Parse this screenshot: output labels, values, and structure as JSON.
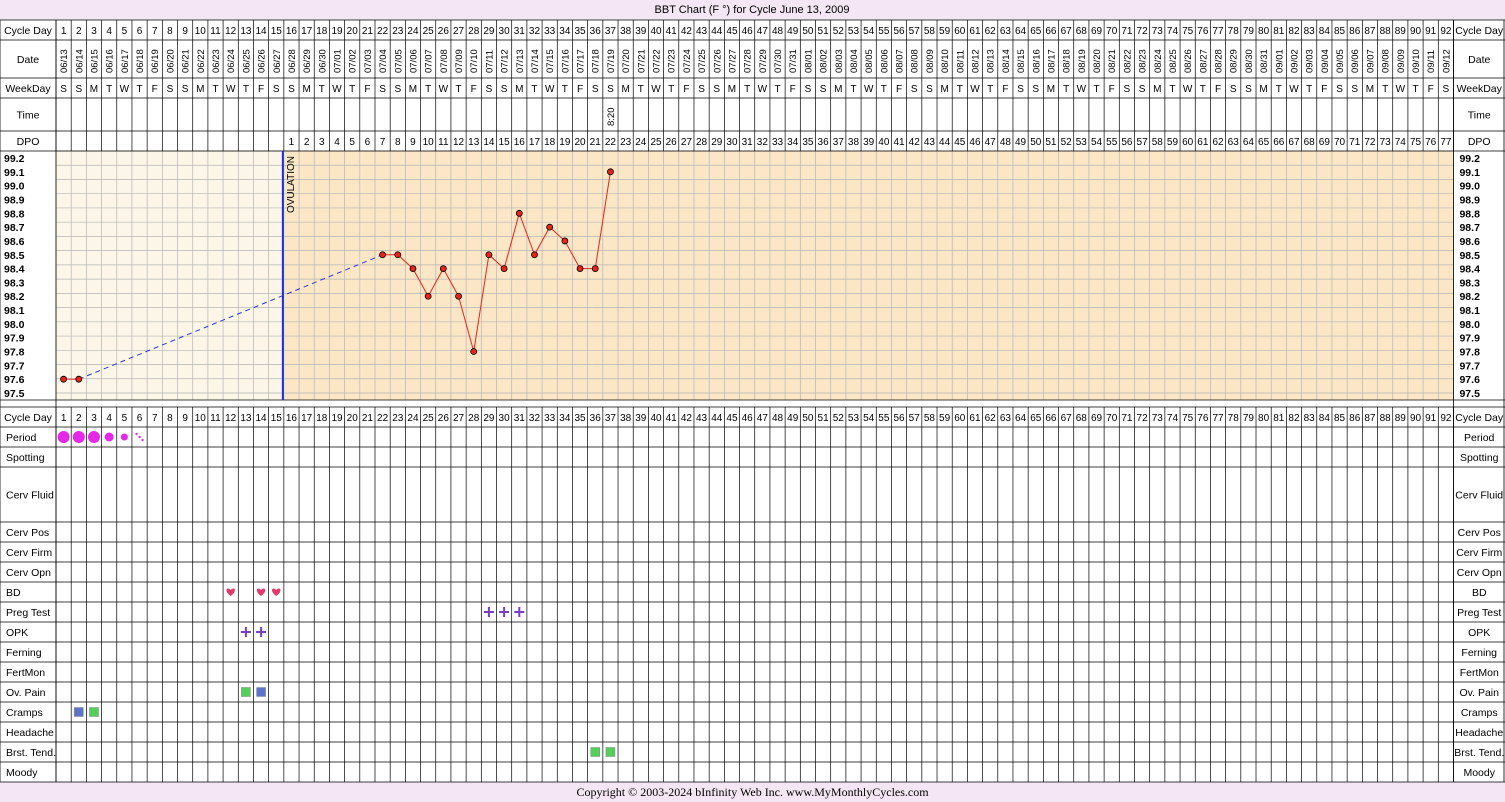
{
  "title": "BBT Chart (F °) for Cycle June 13, 2009",
  "copyright": "Copyright © 2003-2024 bInfinity Web Inc.     www.MyMonthlyCycles.com",
  "ovulation_label": "OVULATION",
  "row_labels": {
    "cycle_day": "Cycle Day",
    "date": "Date",
    "weekday": "WeekDay",
    "time": "Time",
    "dpo": "DPO"
  },
  "observation_rows": [
    "Cycle Day",
    "Period",
    "Spotting",
    "Cerv Fluid",
    "Cerv Pos",
    "Cerv Firm",
    "Cerv Opn",
    "BD",
    "Preg Test",
    "OPK",
    "Ferning",
    "FertMon",
    "Ov. Pain",
    "Cramps",
    "Headache",
    "Brst. Tend.",
    "Moody"
  ],
  "dates": [
    "06/13",
    "06/14",
    "06/15",
    "06/16",
    "06/17",
    "06/18",
    "06/19",
    "06/20",
    "06/21",
    "06/22",
    "06/23",
    "06/24",
    "06/25",
    "06/26",
    "06/27",
    "06/28",
    "06/29",
    "06/30",
    "07/01",
    "07/02",
    "07/03",
    "07/04",
    "07/05",
    "07/06",
    "07/07",
    "07/08",
    "07/09",
    "07/10",
    "07/11",
    "07/12",
    "07/13",
    "07/14",
    "07/15",
    "07/16",
    "07/17",
    "07/18",
    "07/19",
    "07/20",
    "07/21",
    "07/22",
    "07/23",
    "07/24",
    "07/25",
    "07/26",
    "07/27",
    "07/28",
    "07/29",
    "07/30",
    "07/31",
    "08/01",
    "08/02",
    "08/03",
    "08/04",
    "08/05",
    "08/06",
    "08/07",
    "08/08",
    "08/09",
    "08/10",
    "08/11",
    "08/12",
    "08/13",
    "08/14",
    "08/15",
    "08/16",
    "08/17",
    "08/18",
    "08/19",
    "08/20",
    "08/21",
    "08/22",
    "08/23",
    "08/24",
    "08/25",
    "08/26",
    "08/27",
    "08/28",
    "08/29",
    "08/30",
    "08/31",
    "09/01",
    "09/02",
    "09/03",
    "09/04",
    "09/05",
    "09/06",
    "09/07",
    "09/08",
    "09/09",
    "09/10",
    "09/11",
    "09/12"
  ],
  "weekdays": [
    "S",
    "S",
    "M",
    "T",
    "W",
    "T",
    "F",
    "S",
    "S",
    "M",
    "T",
    "W",
    "T",
    "F",
    "S",
    "S",
    "M",
    "T",
    "W",
    "T",
    "F",
    "S",
    "S",
    "M",
    "T",
    "W",
    "T",
    "F",
    "S",
    "S",
    "M",
    "T",
    "W",
    "T",
    "F",
    "S",
    "S",
    "M",
    "T",
    "W",
    "T",
    "F",
    "S",
    "S",
    "M",
    "T",
    "W",
    "T",
    "F",
    "S",
    "S",
    "M",
    "T",
    "W",
    "T",
    "F",
    "S",
    "S",
    "M",
    "T",
    "W",
    "T",
    "F",
    "S",
    "S",
    "M",
    "T",
    "W",
    "T",
    "F",
    "S",
    "S",
    "M",
    "T",
    "W",
    "T",
    "F",
    "S",
    "S",
    "M",
    "T",
    "W",
    "T",
    "F",
    "S",
    "S",
    "M",
    "T",
    "W",
    "T",
    "F",
    "S"
  ],
  "times": [
    {
      "day": 37,
      "text": "8:20"
    }
  ],
  "dpo_start_day": 16,
  "dpo_count": 77,
  "chart_data": {
    "type": "line",
    "title": "BBT Chart (F °) for Cycle June 13, 2009",
    "x_label": "Cycle Day",
    "y_label": "",
    "x_range": [
      1,
      92
    ],
    "ylim": [
      97.5,
      99.2
    ],
    "y_ticks": [
      "99.2",
      "99.1",
      "99.0",
      "98.9",
      "98.8",
      "98.7",
      "98.6",
      "98.5",
      "98.4",
      "98.3",
      "98.2",
      "98.1",
      "98.0",
      "97.9",
      "97.8",
      "97.7",
      "97.6",
      "97.5"
    ],
    "grid": true,
    "ovulation_day": 15,
    "coverline": null,
    "series": [
      {
        "points": [
          {
            "x": 1,
            "y": 97.6
          },
          {
            "x": 2,
            "y": 97.6
          },
          {
            "x": 22,
            "y": 98.5
          },
          {
            "x": 23,
            "y": 98.5
          },
          {
            "x": 24,
            "y": 98.4
          },
          {
            "x": 25,
            "y": 98.2
          },
          {
            "x": 26,
            "y": 98.4
          },
          {
            "x": 27,
            "y": 98.2
          },
          {
            "x": 28,
            "y": 97.8
          },
          {
            "x": 29,
            "y": 98.5
          },
          {
            "x": 30,
            "y": 98.4
          },
          {
            "x": 31,
            "y": 98.8
          },
          {
            "x": 32,
            "y": 98.5
          },
          {
            "x": 33,
            "y": 98.7
          },
          {
            "x": 34,
            "y": 98.6
          },
          {
            "x": 35,
            "y": 98.4
          },
          {
            "x": 36,
            "y": 98.4
          },
          {
            "x": 37,
            "y": 99.1
          }
        ],
        "gaps": [
          [
            2,
            22
          ]
        ]
      }
    ]
  },
  "observations": {
    "period": [
      {
        "day": 1,
        "level": "heavy"
      },
      {
        "day": 2,
        "level": "heavy"
      },
      {
        "day": 3,
        "level": "heavy"
      },
      {
        "day": 4,
        "level": "medium"
      },
      {
        "day": 5,
        "level": "light"
      },
      {
        "day": 6,
        "level": "spotting"
      }
    ],
    "bd": [
      12,
      14,
      15
    ],
    "preg_test": [
      29,
      30,
      31
    ],
    "opk": [
      13,
      14
    ],
    "ov_pain": [
      {
        "day": 13,
        "color": "green"
      },
      {
        "day": 14,
        "color": "blue"
      }
    ],
    "cramps": [
      {
        "day": 2,
        "color": "blue"
      },
      {
        "day": 3,
        "color": "green"
      }
    ],
    "brst_tend": [
      {
        "day": 36,
        "color": "green"
      },
      {
        "day": 37,
        "color": "green"
      }
    ]
  },
  "colors": {
    "background": "#f4e6f4",
    "pre_ovulation_fill": "#fbf6e7",
    "post_ovulation_fill": "#fbe7c6",
    "grid": "#b5b5b5",
    "ovulation_line": "#1b2fd8",
    "temp_line": "#e8231c",
    "gap_line": "#2d34d8",
    "period": "#e629e6",
    "heart": "#e2386a",
    "plus": "#7a3ec2",
    "green": "#54d05a",
    "blue": "#5b73c9"
  }
}
